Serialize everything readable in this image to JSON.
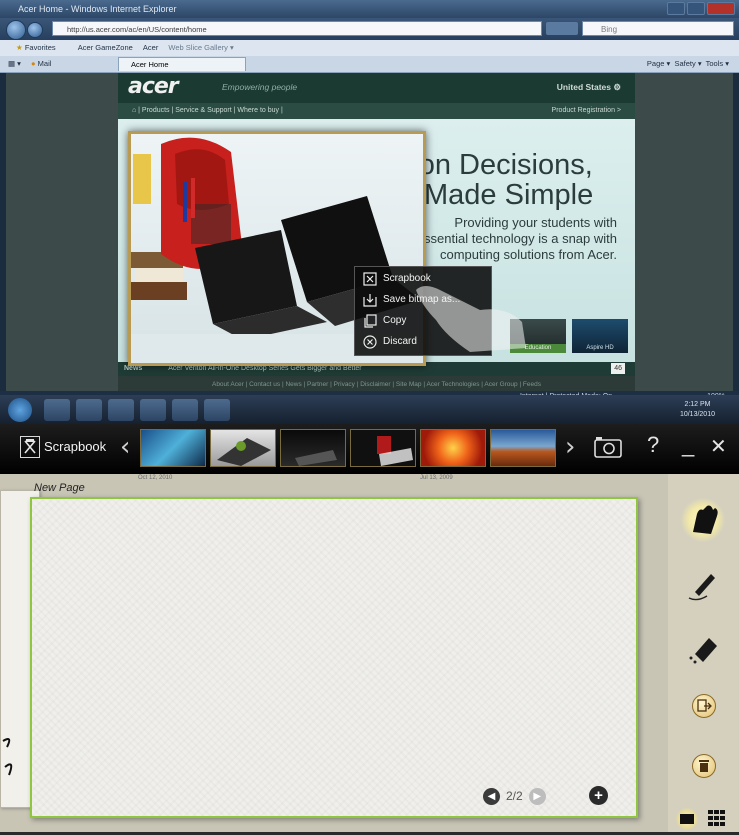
{
  "browser": {
    "window_title": "Acer Home - Windows Internet Explorer",
    "address_host": "acer.com",
    "address_url": "http://us.acer.com/ac/en/US/content/home",
    "search_placeholder": "Bing",
    "favorites_label": "Favorites",
    "fav_links": [
      "Acer GameZone",
      "Acer",
      "Web Slice Gallery ▾"
    ],
    "mail_label": "Mail",
    "tab_label": "Acer Home",
    "command_items": [
      "Page ▾",
      "Safety ▾",
      "Tools ▾"
    ],
    "status_text": "Internet | Protected Mode: On",
    "zoom": "100%"
  },
  "website": {
    "logo": "acer",
    "tagline": "Empowering people",
    "region": "United States ⚙",
    "nav": "⌂  |  Products  |  Service & Support  |  Where to buy  |",
    "nav_right": "Product Registration >",
    "hero_title_1": "Education Decisions,",
    "hero_title_2": "Made Simple",
    "hero_body": [
      "Providing your students with",
      "essential technology is a snap with",
      "computing solutions from Acer."
    ],
    "news_label": "News",
    "news_text": "Acer Veriton All-in-One Desktop Series Gets Bigger and Better",
    "like_count": "46",
    "footer_text": "About Acer | Contact us | News | Partner | Privacy | Disclaimer | Site Map | Acer Technologies | Acer Group | Feeds",
    "promo_labels": [
      "Education",
      "Aspire HD"
    ]
  },
  "context_menu": {
    "items": [
      "Scrapbook",
      "Save bitmap as...",
      "Copy",
      "Discard"
    ]
  },
  "taskbar": {
    "clock_time": "2:12 PM",
    "clock_date": "10/13/2010"
  },
  "scrapbook": {
    "title": "Scrapbook",
    "date_left": "Oct 12, 2010",
    "date_right": "Jul 13, 2009",
    "help": "?",
    "minimize": "_",
    "close": "✕",
    "prev": "‹",
    "next": "›"
  },
  "page": {
    "label": "New Page",
    "current": "2/2"
  },
  "tools": [
    "hand-tool",
    "pen-tool",
    "eraser-tool",
    "export",
    "delete"
  ],
  "colors": {
    "canvas_border": "#8ec63f",
    "menu_bg": "#0a0a0a",
    "frame_gold": "#b89a52"
  }
}
